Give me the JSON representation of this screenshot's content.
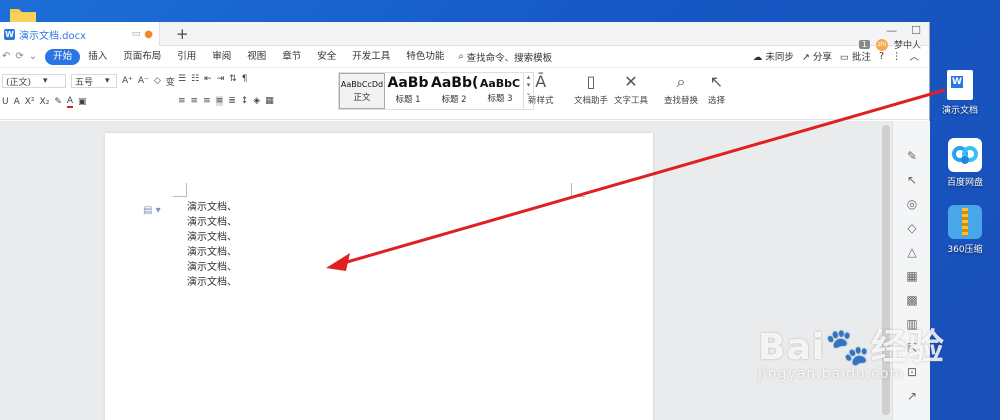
{
  "window": {
    "tab_title": "演示文档.docx",
    "tab_app_letter": "W",
    "new_tab_symbol": "+",
    "page_count_badge": "1",
    "user_name": "梦中人",
    "avatar_text": "zhi"
  },
  "menu": {
    "items": [
      "开始",
      "插入",
      "页面布局",
      "引用",
      "审阅",
      "视图",
      "章节",
      "安全",
      "开发工具",
      "特色功能"
    ],
    "active": "开始",
    "search_label": "查找命令、搜索模板",
    "right_items": [
      "未同步",
      "分享",
      "批注"
    ]
  },
  "ribbon": {
    "font_name": "(正文)",
    "font_size": "五号",
    "styles": [
      {
        "preview": "AaBbCcDd",
        "name": "正文"
      },
      {
        "preview": "AaBb",
        "name": "标题 1"
      },
      {
        "preview": "AaBb(",
        "name": "标题 2"
      },
      {
        "preview": "AaBbC",
        "name": "标题 3"
      }
    ],
    "new_style_label": "新样式",
    "doc_helper_label": "文档助手",
    "text_tools_label": "文字工具",
    "find_replace_label": "查找替换",
    "select_label": "选择"
  },
  "document": {
    "lines": [
      "演示文档、",
      "演示文档、",
      "演示文档、",
      "演示文档、",
      "演示文档、",
      "演示文档、"
    ]
  },
  "desktop": {
    "icons": [
      {
        "label": "演示文档",
        "icon": "word-doc-icon"
      },
      {
        "label": "百度网盘",
        "icon": "baidu-netdisk-icon"
      },
      {
        "label": "360压缩",
        "icon": "zip-archive-icon"
      }
    ]
  },
  "watermark": {
    "brand": "Bai",
    "brand_suffix": "经验",
    "url": "jingyan.baidu.com"
  },
  "colors": {
    "accent": "#2b76e5",
    "arrow": "#e02020",
    "desktop": "#1a5fc8"
  }
}
